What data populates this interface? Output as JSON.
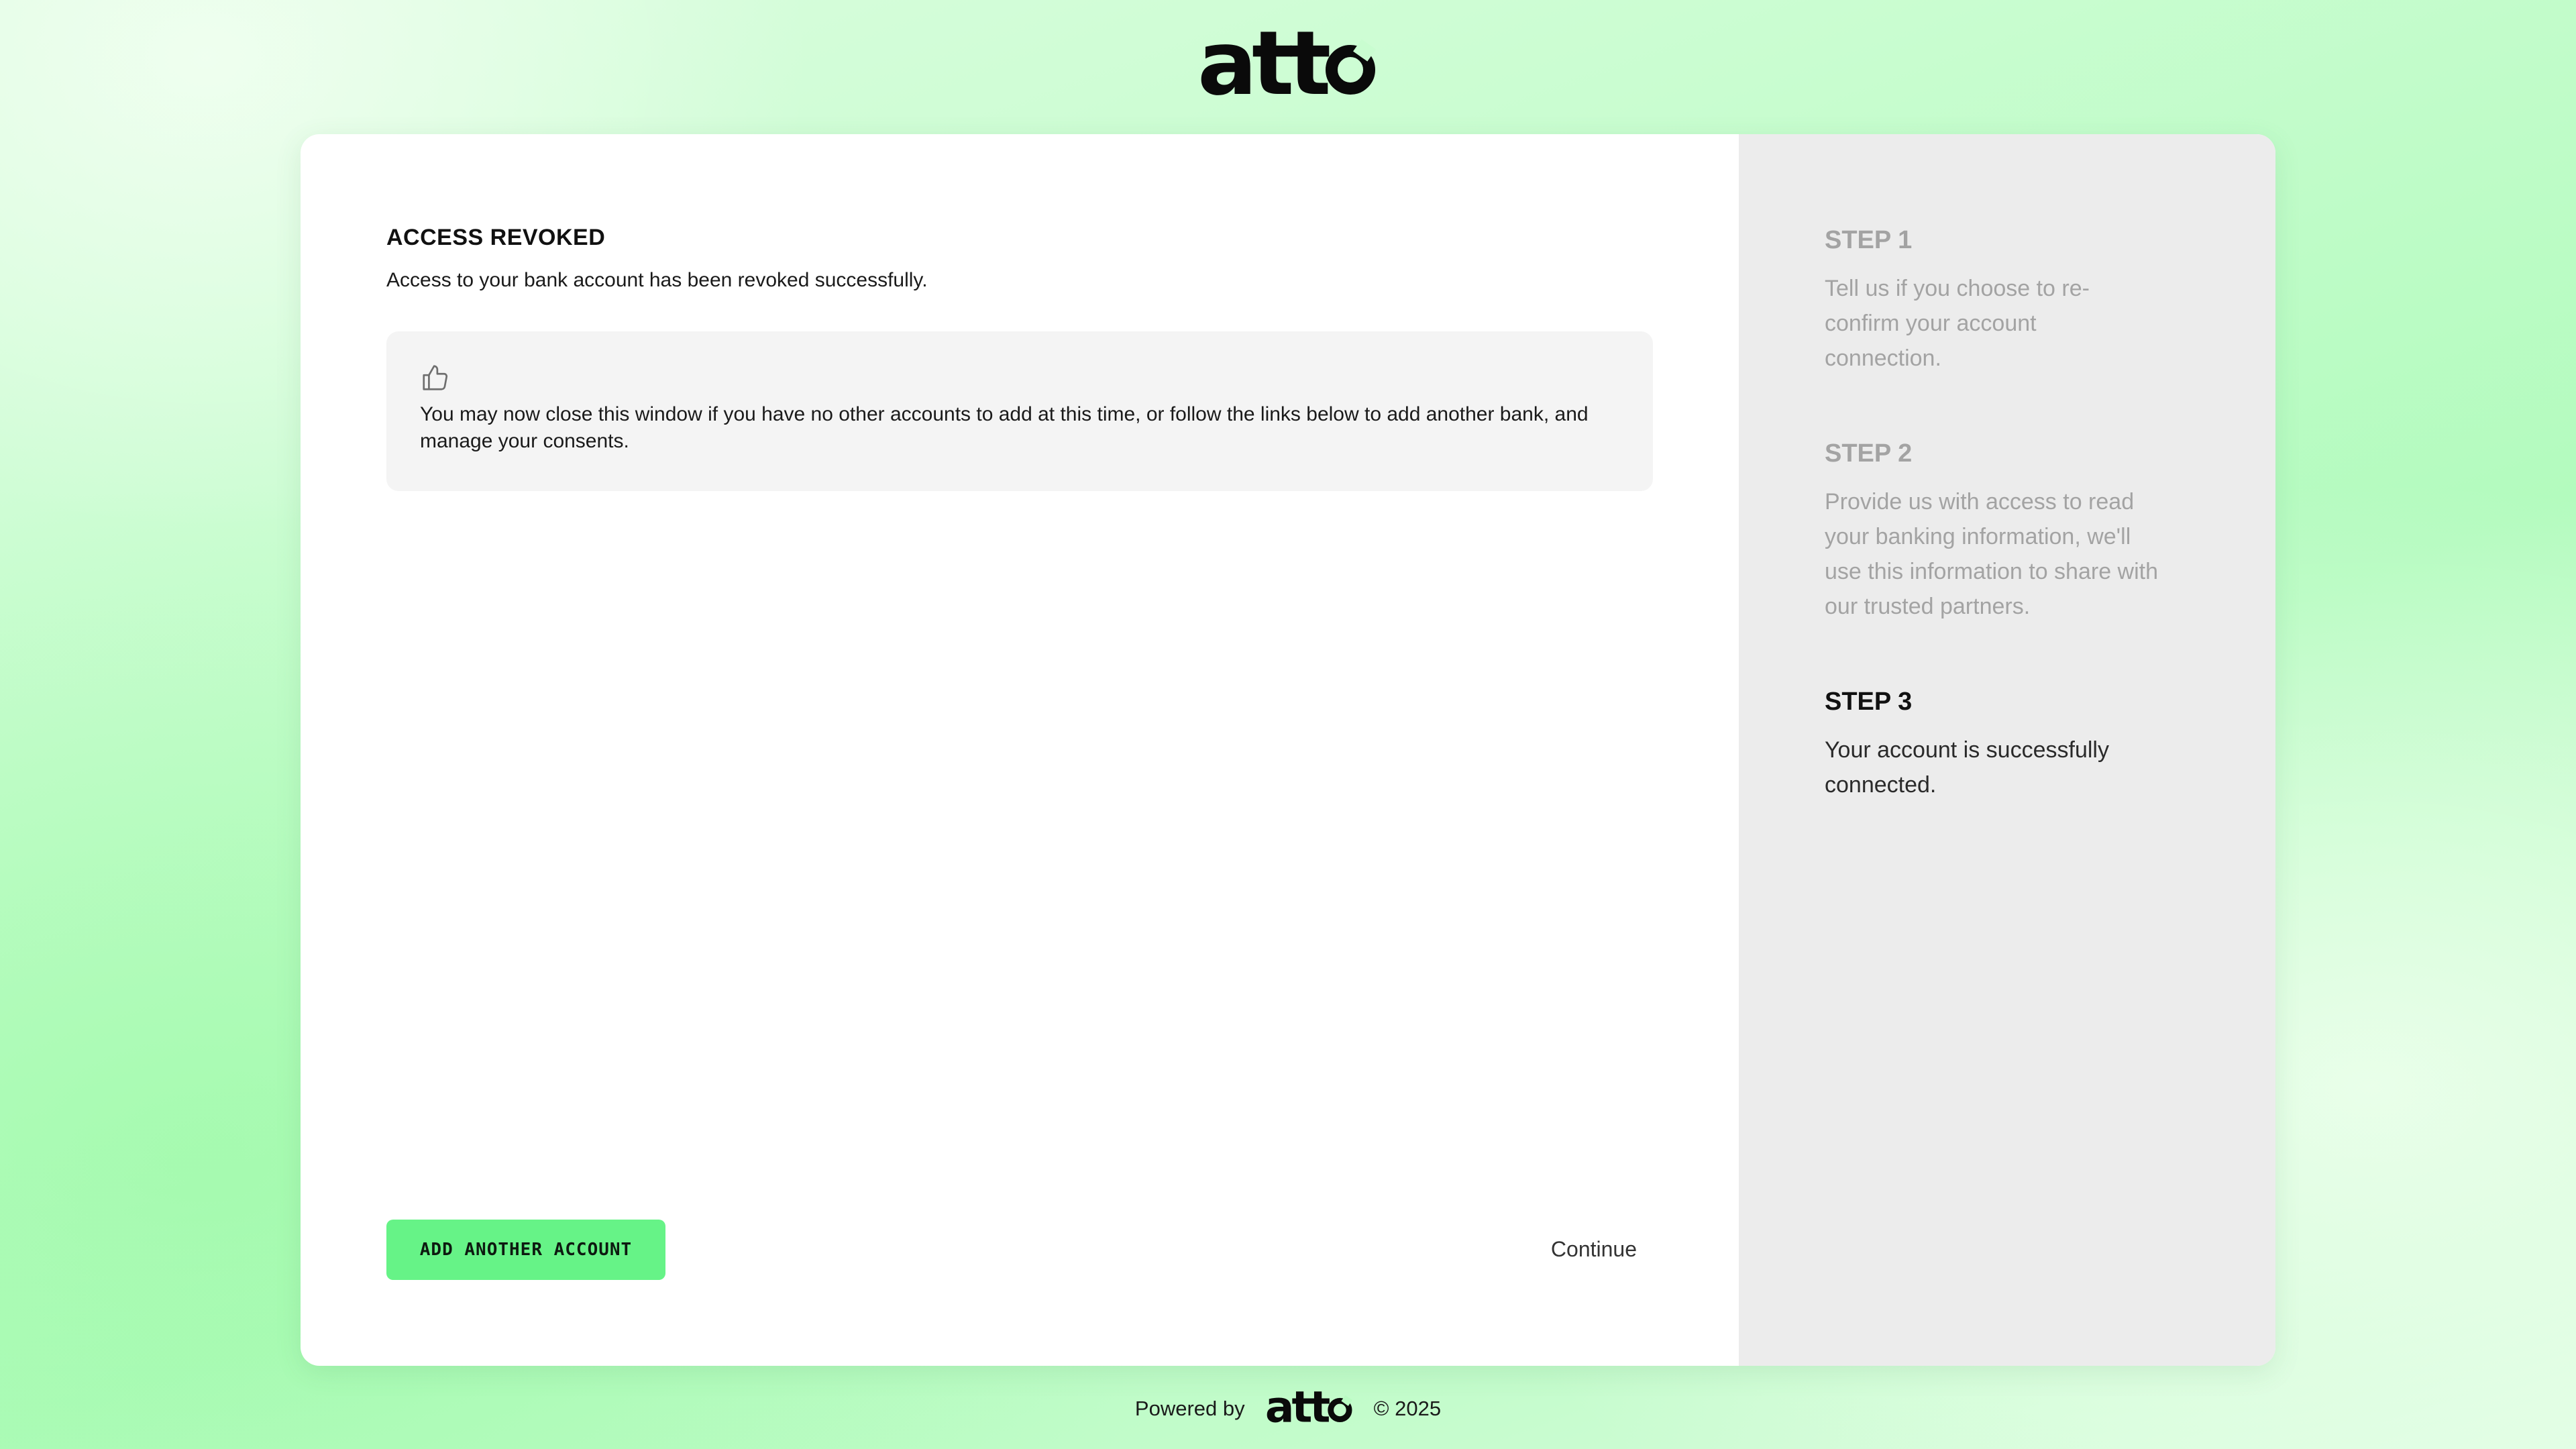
{
  "brand": {
    "logo_name": "atto",
    "logo_icon": "atto-logo"
  },
  "main": {
    "title": "ACCESS REVOKED",
    "subtitle": "Access to your bank account has been revoked successfully.",
    "notice": {
      "icon": "thumbs-up-icon",
      "text": "You may now close this window if you have no other accounts to add at this time, or follow the links below to add another bank, and manage your consents."
    },
    "add_button_label": "ADD ANOTHER ACCOUNT",
    "continue_label": "Continue"
  },
  "steps": [
    {
      "title": "STEP 1",
      "desc": "Tell us if you choose to re-confirm your account connection.",
      "active": false
    },
    {
      "title": "STEP 2",
      "desc": "Provide us with access to read your banking information, we'll use this information to share with our trusted partners.",
      "active": false
    },
    {
      "title": "STEP 3",
      "desc": "Your account is successfully connected.",
      "active": true
    }
  ],
  "footer": {
    "powered_by": "Powered by",
    "copyright": "© 2025"
  },
  "colors": {
    "accent_button": "#66f387",
    "side_panel": "#ececec",
    "notice_bg": "#f4f4f4"
  }
}
